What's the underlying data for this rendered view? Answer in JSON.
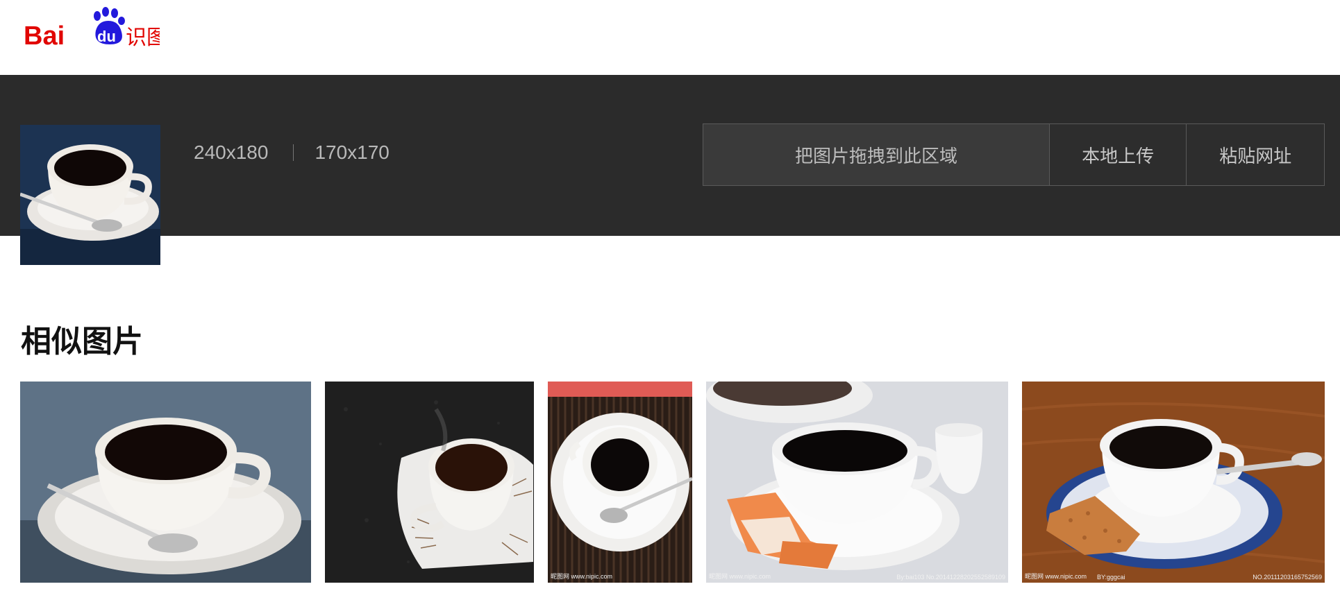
{
  "logo": {
    "text_en": "Bai",
    "text_du": "du",
    "text_cn": "识图",
    "alt": "Baidu识图"
  },
  "query": {
    "size_original": "240x180",
    "size_thumb": "170x170"
  },
  "upload": {
    "drop_text": "把图片拖拽到此区域",
    "local_upload": "本地上传",
    "paste_url": "粘贴网址"
  },
  "section": {
    "title": "相似图片"
  },
  "watermarks": {
    "nipic1": "昵图网 www.nipic.com",
    "nipic2": "昵图网 www.nipic.com",
    "nipic2_right": "By:bai103 No.20141228202552589109",
    "nipic3": "昵图网 www.nipic.com",
    "nipic3_mid": "BY:gggcai",
    "nipic3_right": "NO.20111203165752569"
  },
  "colors": {
    "logo_red": "#e10602",
    "logo_blue": "#2319dc",
    "banner": "#2b2b2b"
  }
}
